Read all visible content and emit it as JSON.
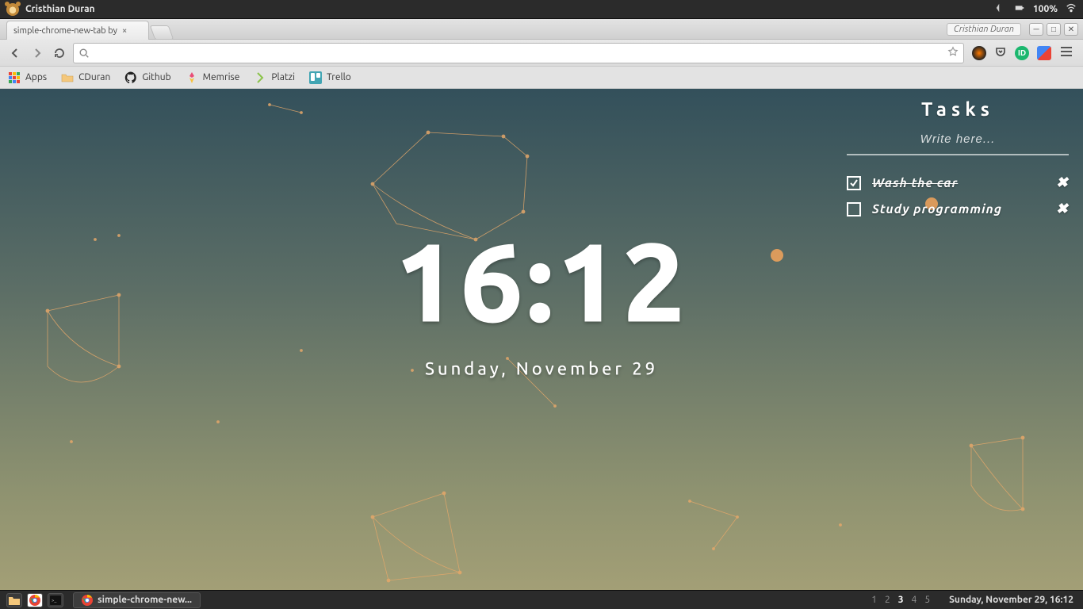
{
  "sysbar": {
    "user": "Cristhian Duran",
    "battery": "100%"
  },
  "window": {
    "owner": "Cristhian Duran"
  },
  "tabs": [
    {
      "title": "simple-chrome-new-tab by"
    }
  ],
  "bookmarks": {
    "apps": "Apps",
    "items": [
      {
        "label": "CDuran"
      },
      {
        "label": "Github"
      },
      {
        "label": "Memrise"
      },
      {
        "label": "Platzi"
      },
      {
        "label": "Trello"
      }
    ]
  },
  "page": {
    "time": "16:12",
    "date": "Sunday, November 29"
  },
  "tasks": {
    "title": "Tasks",
    "placeholder": "Write here...",
    "items": [
      {
        "label": "Wash the car",
        "done": true
      },
      {
        "label": "Study programming",
        "done": false
      }
    ]
  },
  "taskbar": {
    "running": "simple-chrome-new...",
    "workspaces": [
      "1",
      "2",
      "3",
      "4",
      "5"
    ],
    "active_ws": "3",
    "clock": "Sunday, November 29, 16:12"
  }
}
